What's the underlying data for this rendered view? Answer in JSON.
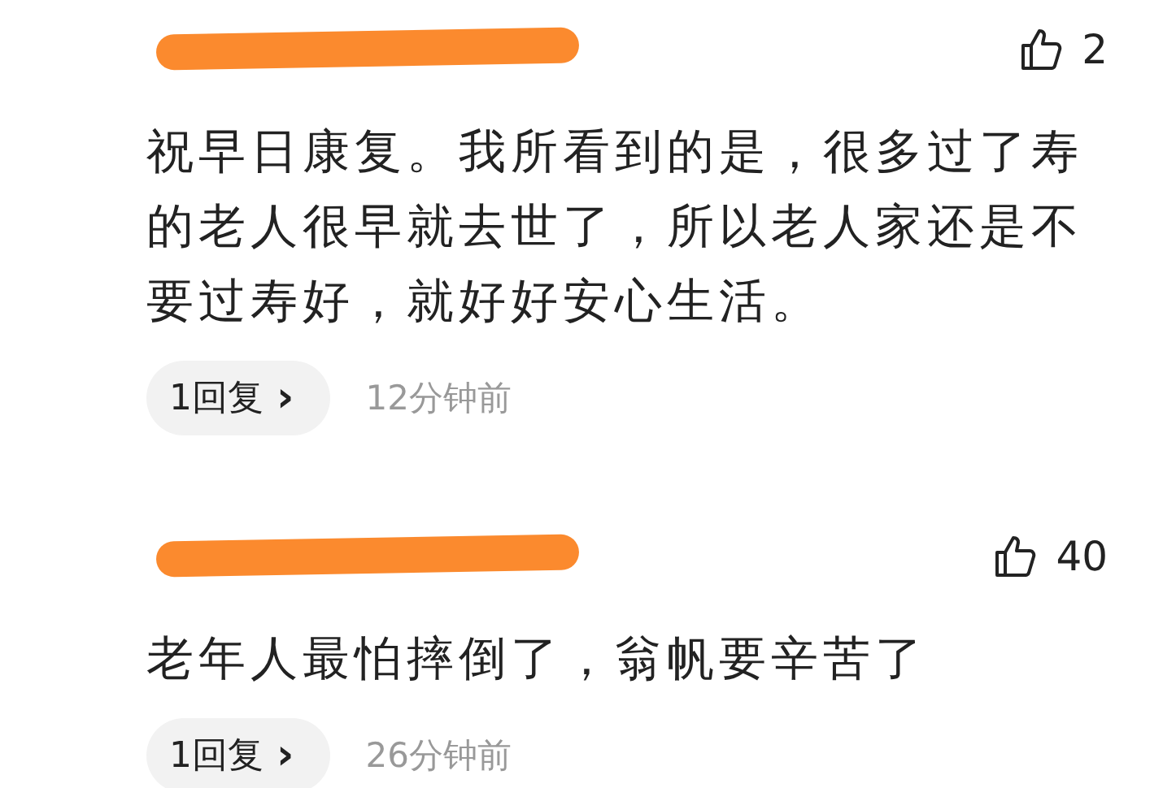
{
  "comments": [
    {
      "likes": "2",
      "text": "祝早日康复。我所看到的是，很多过了寿的老人很早就去世了，所以老人家还是不要过寿好，就好好安心生活。",
      "replies": "1回复",
      "reply_arrow": "›",
      "time": "12分钟前"
    },
    {
      "likes": "40",
      "text": "老年人最怕摔倒了，翁帆要辛苦了",
      "replies": "1回复",
      "reply_arrow": "›",
      "time": "26分钟前"
    }
  ]
}
